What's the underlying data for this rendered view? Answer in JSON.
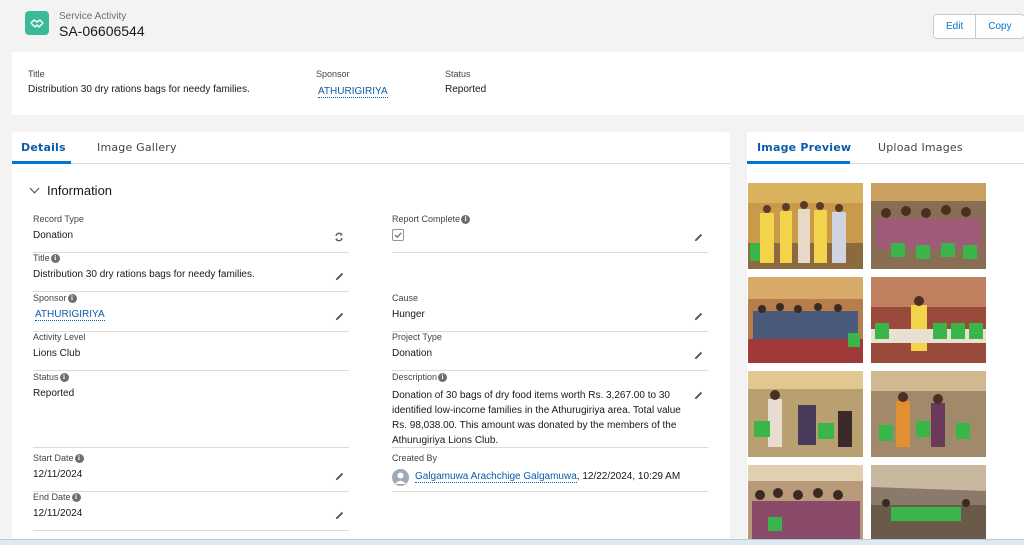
{
  "header": {
    "object_type": "Service Activity",
    "record_name": "SA-06606544",
    "edit_label": "Edit",
    "copy_label": "Copy",
    "icon": "handshake-icon"
  },
  "highlights": {
    "title_label": "Title",
    "title_value": "Distribution 30 dry rations bags for needy families.",
    "sponsor_label": "Sponsor",
    "sponsor_value": "ATHURIGIRIYA",
    "status_label": "Status",
    "status_value": "Reported"
  },
  "left_tabs": [
    {
      "label": "Details",
      "active": true
    },
    {
      "label": "Image Gallery",
      "active": false
    }
  ],
  "right_tabs": [
    {
      "label": "Image Preview",
      "active": true
    },
    {
      "label": "Upload Images",
      "active": false
    }
  ],
  "section_title": "Information",
  "fields": {
    "record_type": {
      "label": "Record Type",
      "value": "Donation"
    },
    "report_complete": {
      "label": "Report Complete",
      "checked": true
    },
    "title": {
      "label": "Title",
      "value": "Distribution 30 dry rations bags for needy families."
    },
    "sponsor": {
      "label": "Sponsor",
      "value": "ATHURIGIRIYA"
    },
    "cause": {
      "label": "Cause",
      "value": "Hunger"
    },
    "activity_level": {
      "label": "Activity Level",
      "value": "Lions Club"
    },
    "project_type": {
      "label": "Project Type",
      "value": "Donation"
    },
    "status": {
      "label": "Status",
      "value": "Reported"
    },
    "description": {
      "label": "Description",
      "value": "Donation of 30 bags of dry food items worth Rs. 3,267.00 to 30 identified low-income families in the Athurugiriya area. Total value Rs. 98,038.00. This amount was donated by the members of the Athurugiriya Lions Club."
    },
    "start_date": {
      "label": "Start Date",
      "value": "12/11/2024"
    },
    "created_by": {
      "label": "Created By",
      "user": "Galgamuwa Arachchige Galgamuwa",
      "timestamp": ", 12/22/2024, 10:29 AM"
    },
    "end_date": {
      "label": "End Date",
      "value": "12/11/2024"
    }
  },
  "colors": {
    "brand": "#0176d3",
    "link": "#0b5cab",
    "icon_teal": "#3bba9a"
  }
}
